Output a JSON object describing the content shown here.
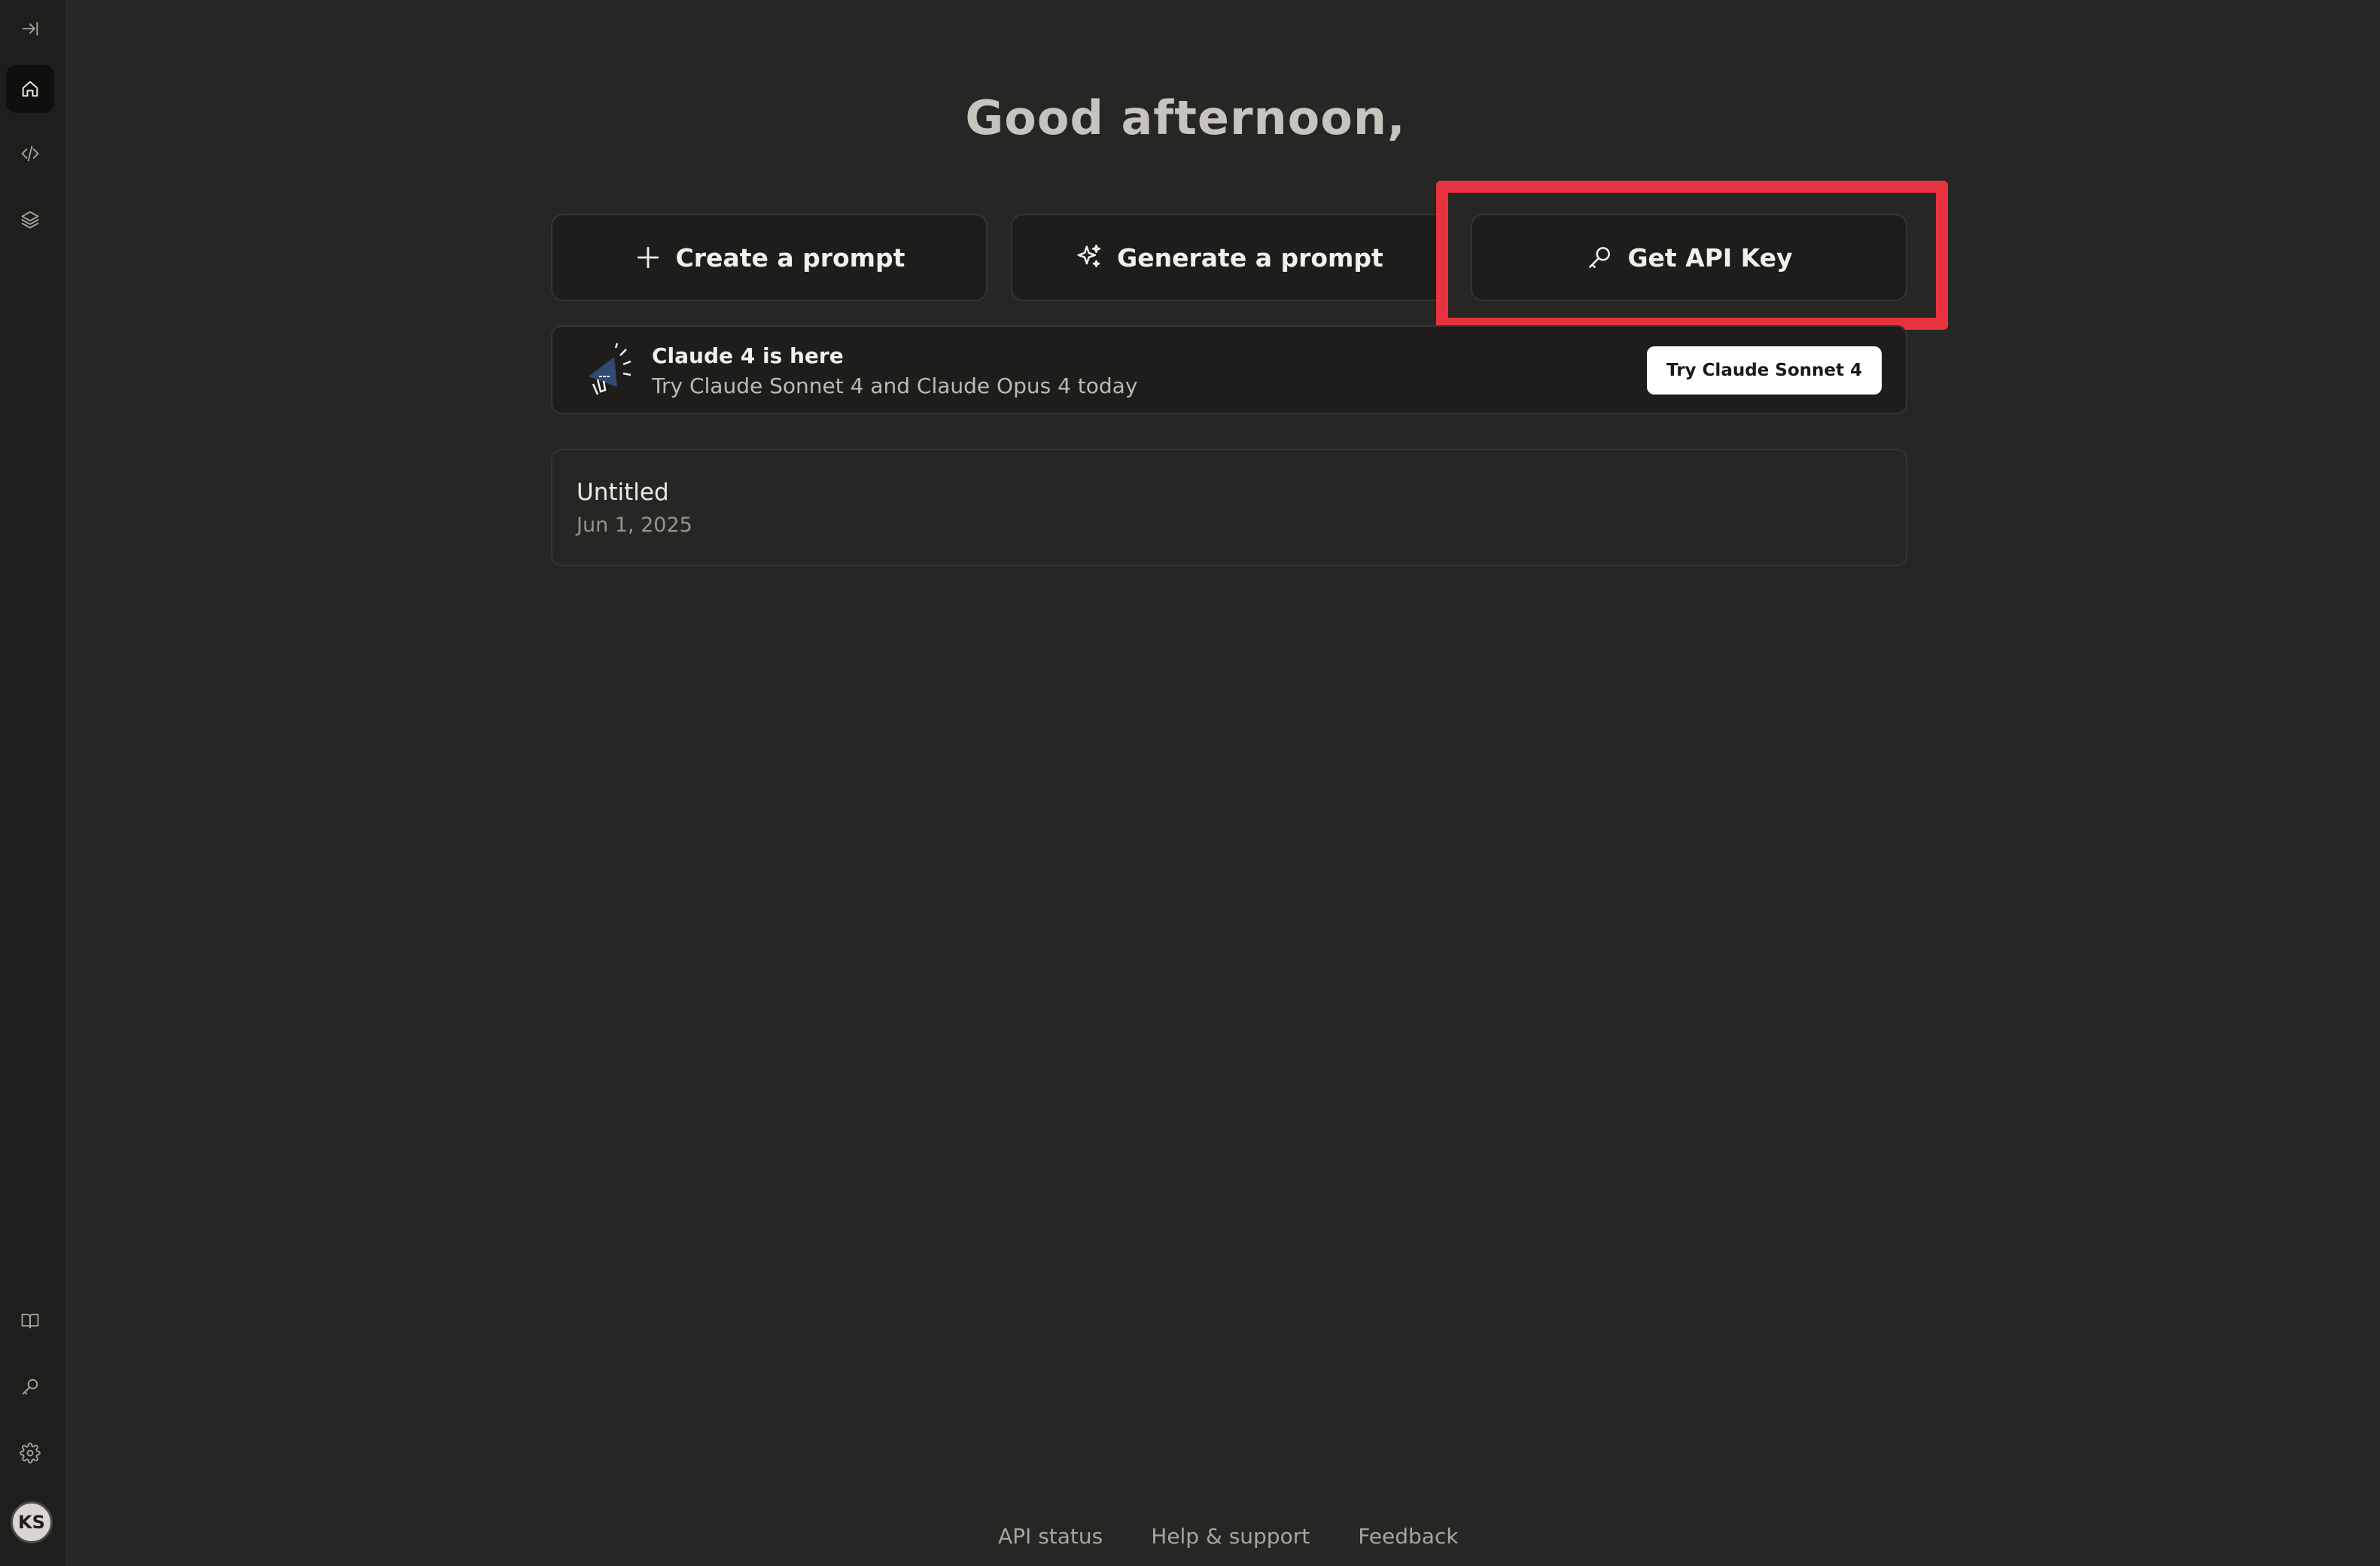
{
  "sidebar": {
    "top_items": [
      {
        "icon": "expand-sidebar-icon"
      },
      {
        "icon": "home-icon",
        "active": true
      },
      {
        "icon": "code-icon"
      },
      {
        "icon": "layers-icon"
      }
    ],
    "bottom_items": [
      {
        "icon": "book-icon"
      },
      {
        "icon": "key-icon"
      },
      {
        "icon": "gear-icon"
      }
    ],
    "avatar_initials": "KS"
  },
  "main": {
    "greeting": "Good afternoon,",
    "actions": [
      {
        "label": "Create a prompt",
        "icon": "plus-icon"
      },
      {
        "label": "Generate a prompt",
        "icon": "sparkle-icon"
      },
      {
        "label": "Get API Key",
        "icon": "key-icon"
      }
    ],
    "announcement": {
      "title": "Claude 4 is here",
      "subtitle": "Try Claude Sonnet 4 and Claude Opus 4 today",
      "cta_label": "Try Claude Sonnet 4",
      "icon": "megaphone-icon"
    },
    "recent": [
      {
        "title": "Untitled",
        "date": "Jun 1, 2025"
      }
    ]
  },
  "footer": {
    "links": [
      "API status",
      "Help & support",
      "Feedback"
    ]
  },
  "colors": {
    "background": "#262624",
    "sidebar": "#1f1e1d",
    "highlight": "#e8323f"
  }
}
